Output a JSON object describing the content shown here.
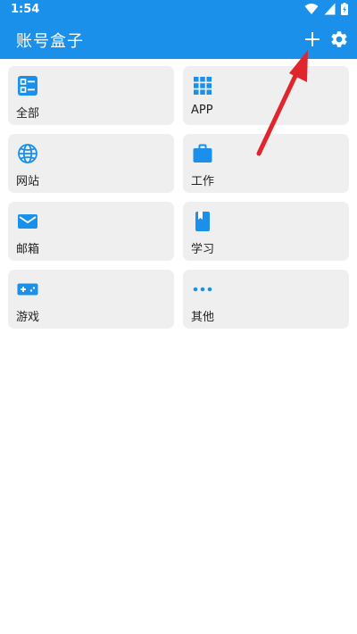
{
  "status_bar": {
    "time": "1:54",
    "icons": [
      "wifi-icon",
      "signal-icon",
      "battery-icon"
    ]
  },
  "app_bar": {
    "title": "账号盒子",
    "actions": [
      "add-icon",
      "gear-icon"
    ]
  },
  "categories": [
    {
      "label": "全部",
      "icon": "list-icon"
    },
    {
      "label": "APP",
      "icon": "apps-grid-icon"
    },
    {
      "label": "网站",
      "icon": "globe-icon"
    },
    {
      "label": "工作",
      "icon": "briefcase-icon"
    },
    {
      "label": "邮箱",
      "icon": "mail-icon"
    },
    {
      "label": "学习",
      "icon": "book-icon"
    },
    {
      "label": "游戏",
      "icon": "gamepad-icon"
    },
    {
      "label": "其他",
      "icon": "more-dots-icon"
    }
  ],
  "colors": {
    "primary": "#1a90ea",
    "icon": "#1a90ea",
    "card_bg": "#efefef",
    "annotation_arrow": "#e0262c"
  }
}
